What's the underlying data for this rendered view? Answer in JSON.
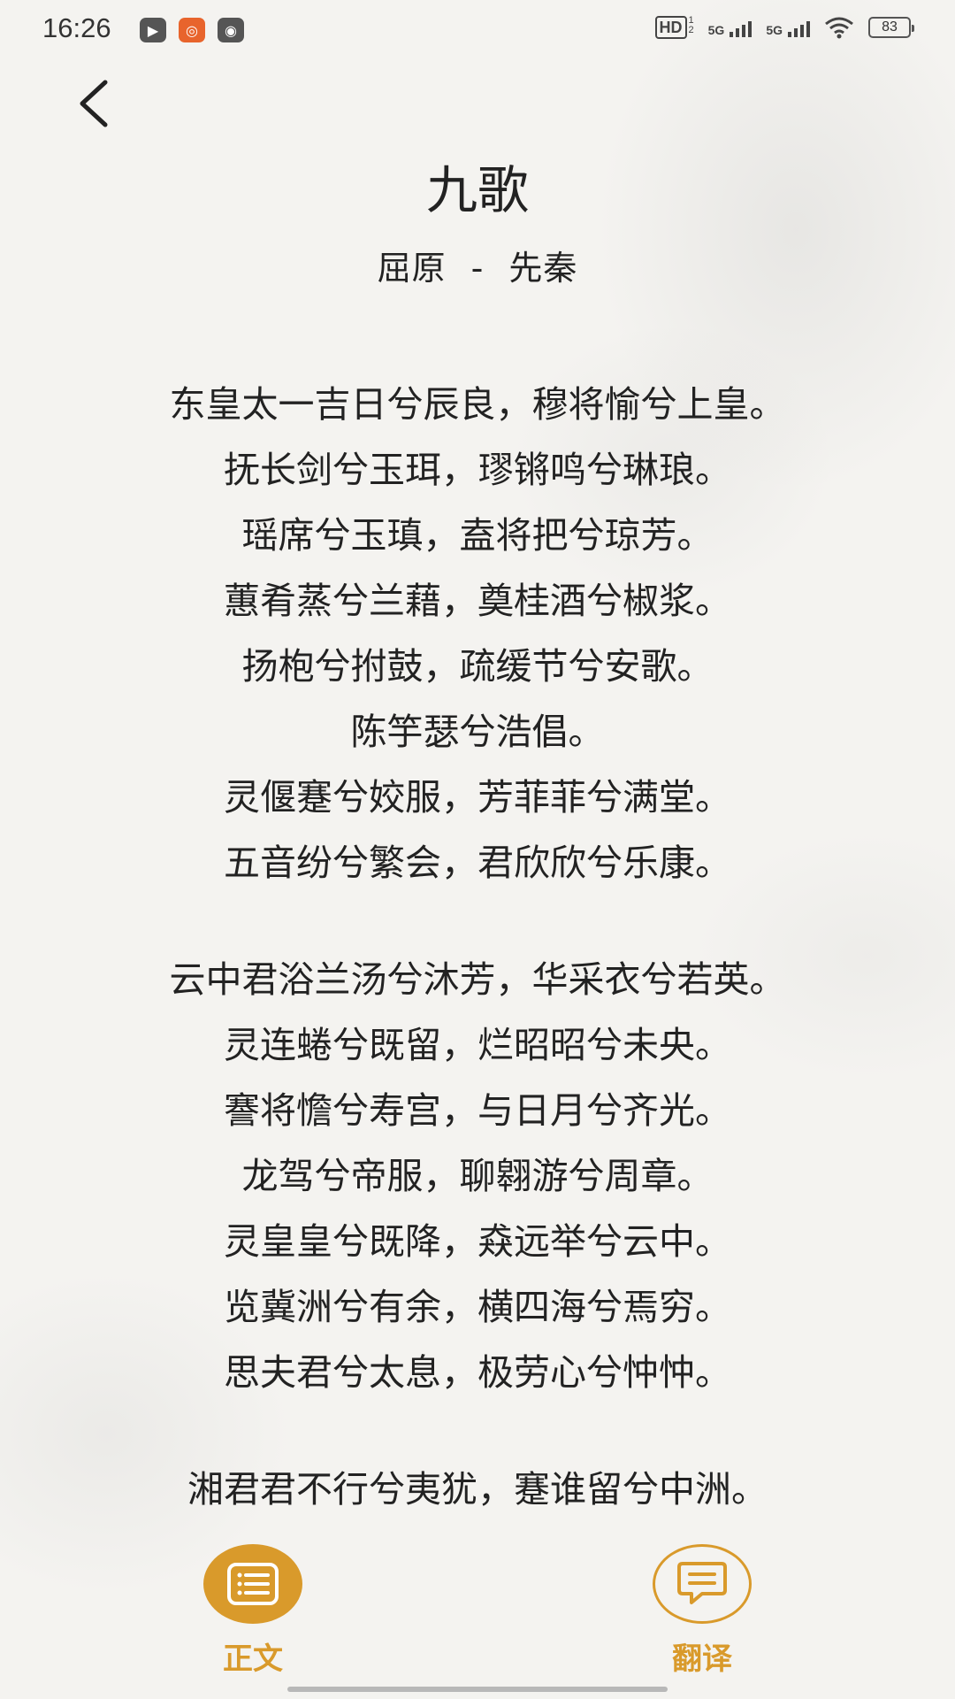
{
  "status_bar": {
    "time": "16:26",
    "hd_label": "HD",
    "hd_sub": "1",
    "hd_sub2": "2",
    "signal1_label": "5G",
    "signal2_label": "5G",
    "battery": "83"
  },
  "header": {
    "back_icon": "chevron-left-icon",
    "title": "九歌",
    "author": "屈原",
    "separator": "-",
    "dynasty": "先秦"
  },
  "poem": {
    "stanzas": [
      [
        "东皇太一吉日兮辰良，穆将愉兮上皇。",
        "抚长剑兮玉珥，璆锵鸣兮琳琅。",
        "瑶席兮玉瑱，盍将把兮琼芳。",
        "蕙肴蒸兮兰藉，奠桂酒兮椒浆。",
        "扬枹兮拊鼓，疏缓节兮安歌。",
        "陈竽瑟兮浩倡。",
        "灵偃蹇兮姣服，芳菲菲兮满堂。",
        "五音纷兮繁会，君欣欣兮乐康。"
      ],
      [
        "云中君浴兰汤兮沐芳，华采衣兮若英。",
        "灵连蜷兮既留，烂昭昭兮未央。",
        "謇将憺兮寿宫，与日月兮齐光。",
        "龙驾兮帝服，聊翱游兮周章。",
        "灵皇皇兮既降，猋远举兮云中。",
        "览冀洲兮有余，横四海兮焉穷。",
        "思夫君兮太息，极劳心兮忡忡。"
      ],
      [
        "湘君君不行兮夷犹，蹇谁留兮中洲。"
      ]
    ]
  },
  "bottom_bar": {
    "tabs": [
      {
        "label": "正文",
        "icon": "list-icon",
        "active": true
      },
      {
        "label": "翻译",
        "icon": "message-icon",
        "active": false
      }
    ]
  },
  "colors": {
    "accent": "#d99a2b",
    "background": "#f4f3f0",
    "text": "#222222"
  }
}
